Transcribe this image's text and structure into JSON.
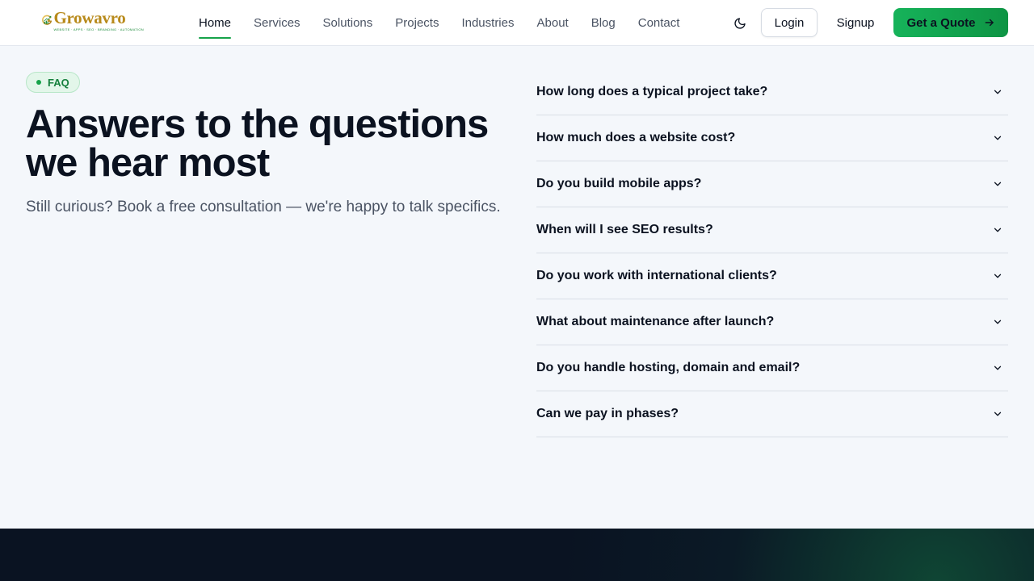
{
  "brand": {
    "name": "Growavro",
    "tagline": "WEBSITE · APPS · SEO · BRANDING · AUTOMATION",
    "colors": {
      "accent": "#16a34a",
      "gold": "#b88a1b"
    }
  },
  "nav": {
    "items": [
      {
        "label": "Home",
        "active": true
      },
      {
        "label": "Services",
        "active": false
      },
      {
        "label": "Solutions",
        "active": false
      },
      {
        "label": "Projects",
        "active": false
      },
      {
        "label": "Industries",
        "active": false
      },
      {
        "label": "About",
        "active": false
      },
      {
        "label": "Blog",
        "active": false
      },
      {
        "label": "Contact",
        "active": false
      }
    ]
  },
  "header": {
    "theme_icon": "moon-icon",
    "login_label": "Login",
    "signup_label": "Signup",
    "quote_label": "Get a Quote",
    "quote_icon": "arrow-right-icon"
  },
  "hero": {
    "badge": "FAQ",
    "headline": "Answers to the questions we hear most",
    "subtext": "Still curious? Book a free consultation — we're happy to talk specifics."
  },
  "faq": {
    "items": [
      {
        "question": "How long does a typical project take?"
      },
      {
        "question": "How much does a website cost?"
      },
      {
        "question": "Do you build mobile apps?"
      },
      {
        "question": "When will I see SEO results?"
      },
      {
        "question": "Do you work with international clients?"
      },
      {
        "question": "What about maintenance after launch?"
      },
      {
        "question": "Do you handle hosting, domain and email?"
      },
      {
        "question": "Can we pay in phases?"
      }
    ]
  }
}
